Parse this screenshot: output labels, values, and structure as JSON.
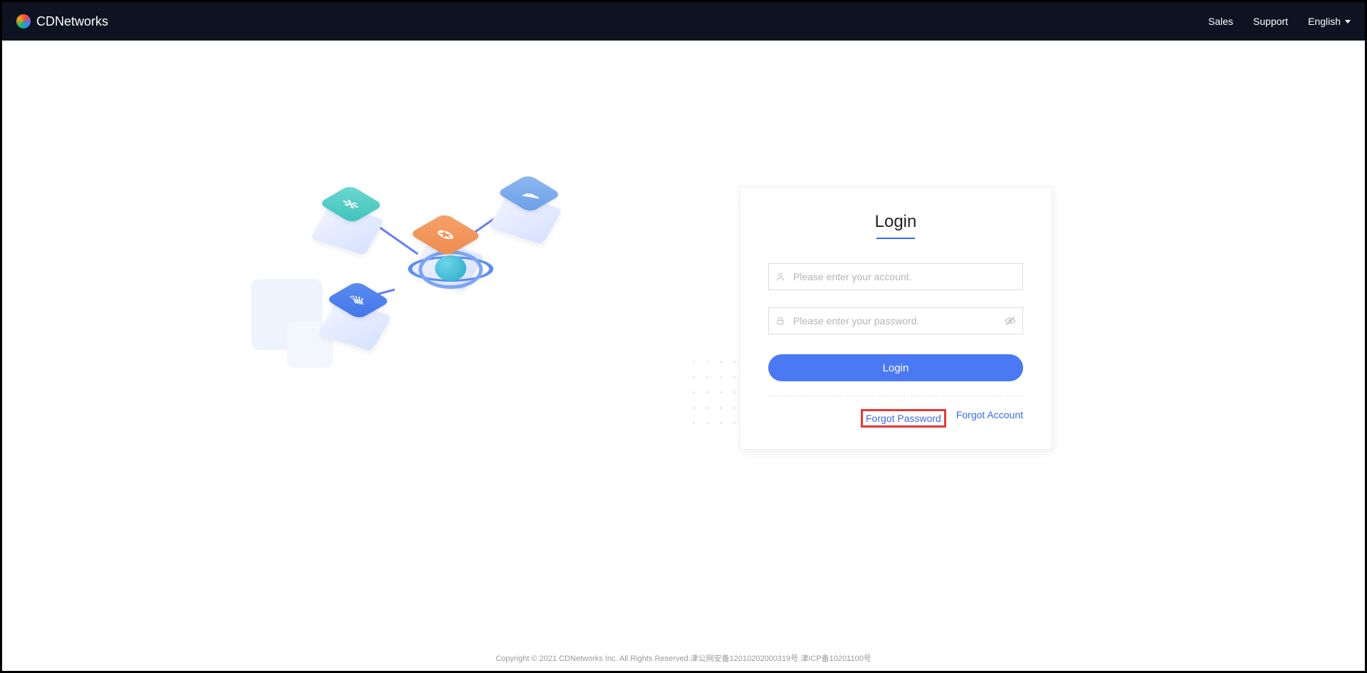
{
  "header": {
    "brand": "CDNetworks",
    "nav": {
      "sales": "Sales",
      "support": "Support",
      "language": "English"
    }
  },
  "login": {
    "title": "Login",
    "account_placeholder": "Please enter your account.",
    "password_placeholder": "Please enter your password.",
    "submit": "Login",
    "forgot_password": "Forgot Password",
    "forgot_account": "Forgot Account"
  },
  "footer": {
    "copyright": "Copyright © 2021 CDNetworks Inc. All Rights Reserved.",
    "beian1": "津公网安备12010202000319号",
    "beian2": "津ICP备10201100号"
  }
}
